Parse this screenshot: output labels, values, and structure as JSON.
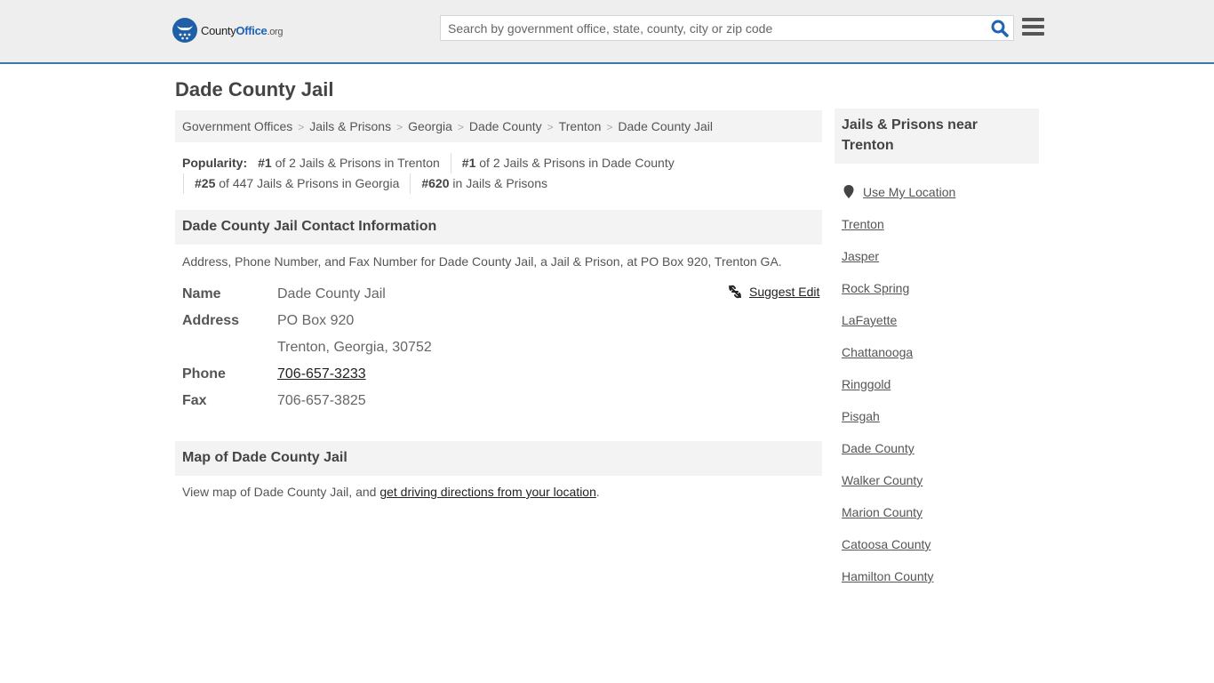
{
  "header": {
    "logo": {
      "name_part1": "County",
      "name_part2": "Office",
      "tld": ".org"
    },
    "search": {
      "placeholder": "Search by government office, state, county, city or zip code",
      "value": ""
    }
  },
  "page_title": "Dade County Jail",
  "breadcrumb": [
    "Government Offices",
    "Jails & Prisons",
    "Georgia",
    "Dade County",
    "Trenton",
    "Dade County Jail"
  ],
  "popularity": {
    "label": "Popularity:",
    "items": [
      {
        "rank": "#1",
        "text": " of 2 Jails & Prisons in Trenton"
      },
      {
        "rank": "#1",
        "text": " of 2 Jails & Prisons in Dade County"
      },
      {
        "rank": "#25",
        "text": " of 447 Jails & Prisons in Georgia"
      },
      {
        "rank": "#620",
        "text": " in Jails & Prisons"
      }
    ]
  },
  "contact": {
    "heading": "Dade County Jail Contact Information",
    "description": "Address, Phone Number, and Fax Number for Dade County Jail, a Jail & Prison, at PO Box 920, Trenton GA.",
    "suggest_edit": "Suggest Edit",
    "fields": {
      "name_label": "Name",
      "name": "Dade County Jail",
      "address_label": "Address",
      "address_line1": "PO Box 920",
      "address_line2": "Trenton, Georgia, 30752",
      "phone_label": "Phone",
      "phone": "706-657-3233",
      "fax_label": "Fax",
      "fax": "706-657-3825"
    }
  },
  "map": {
    "heading": "Map of Dade County Jail",
    "description_prefix": "View map of Dade County Jail, and ",
    "directions_link": "get driving directions from your location",
    "description_suffix": "."
  },
  "sidebar": {
    "heading": "Jails & Prisons near Trenton",
    "use_location": "Use My Location",
    "links": [
      "Trenton",
      "Jasper",
      "Rock Spring",
      "LaFayette",
      "Chattanooga",
      "Ringgold",
      "Pisgah",
      "Dade County",
      "Walker County",
      "Marion County",
      "Catoosa County",
      "Hamilton County"
    ]
  },
  "colors": {
    "accent": "#3a7aab",
    "logo_blue": "#1f5fa8",
    "search_icon": "#1f63b5"
  }
}
